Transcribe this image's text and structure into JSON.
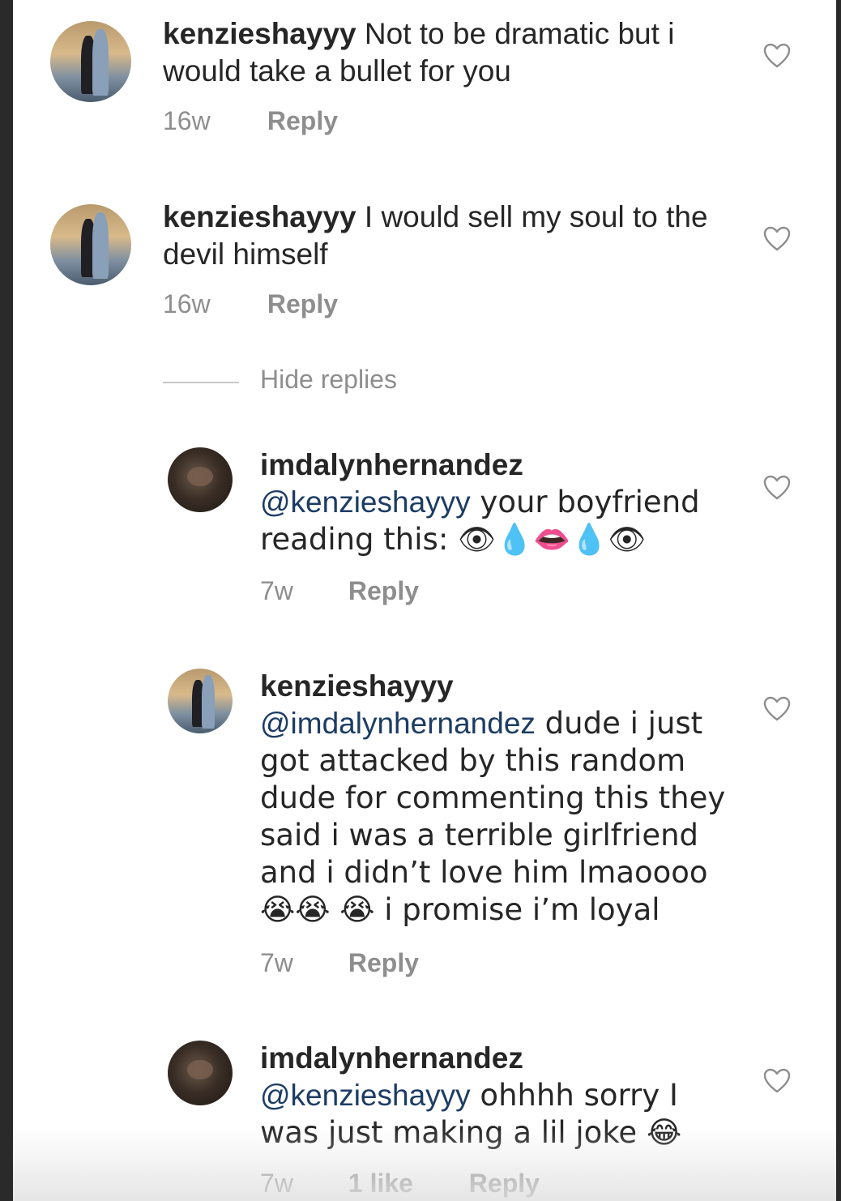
{
  "comments": [
    {
      "username": "kenzieshayyy",
      "text": "Not to be dramatic but i would take a bullet for you",
      "age": "16w",
      "reply": "Reply"
    },
    {
      "username": "kenzieshayyy",
      "text": "I would sell my soul to the devil himself",
      "age": "16w",
      "reply": "Reply"
    }
  ],
  "hide_replies": "Hide replies",
  "replies": [
    {
      "username": "imdalynhernandez",
      "mention": "@kenzieshayyy",
      "text": " your boyfriend reading this: 👁💧👄💧👁",
      "age": "7w",
      "reply": "Reply"
    },
    {
      "username": "kenzieshayyy",
      "mention": "@imdalynhernandez",
      "text": " dude i just got attacked by this random dude for commenting this they said i was a terrible girlfriend and i didn’t love him lmaoooo 😭😭 😭 i promise i’m loyal",
      "age": "7w",
      "reply": "Reply"
    },
    {
      "username": "imdalynhernandez",
      "mention": "@kenzieshayyy",
      "text": " ohhhh sorry I was just making a lil joke 😂",
      "age": "7w",
      "likes": "1 like",
      "reply": "Reply"
    }
  ],
  "icons": {
    "like": "heart-outline-icon"
  },
  "colors": {
    "text": "#262626",
    "secondary": "#8e8e8e",
    "mention": "#1c3c64"
  }
}
